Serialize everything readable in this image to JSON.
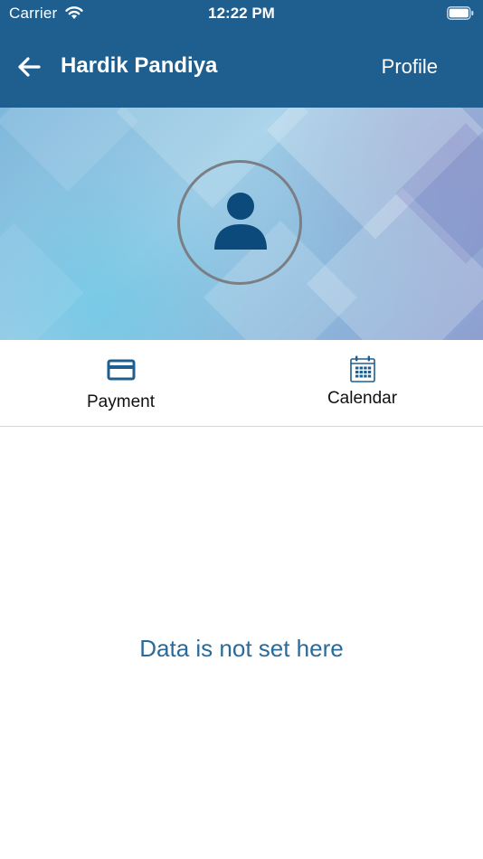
{
  "status_bar": {
    "carrier": "Carrier",
    "time": "12:22 PM",
    "icons": [
      "wifi-icon",
      "battery-icon"
    ]
  },
  "navbar": {
    "back_icon": "arrow-left-icon",
    "title": "Hardik Pandiya",
    "action": "Profile"
  },
  "profile": {
    "avatar_icon": "person-icon"
  },
  "tabs": [
    {
      "label": "Payment",
      "icon": "credit-card-icon"
    },
    {
      "label": "Calendar",
      "icon": "calendar-icon"
    }
  ],
  "content": {
    "empty_message": "Data is not set here"
  },
  "colors": {
    "header": "#1f5f8f",
    "accent": "#1f5f8f",
    "empty_text": "#2b6b9a",
    "avatar": "#0b4a7a"
  }
}
